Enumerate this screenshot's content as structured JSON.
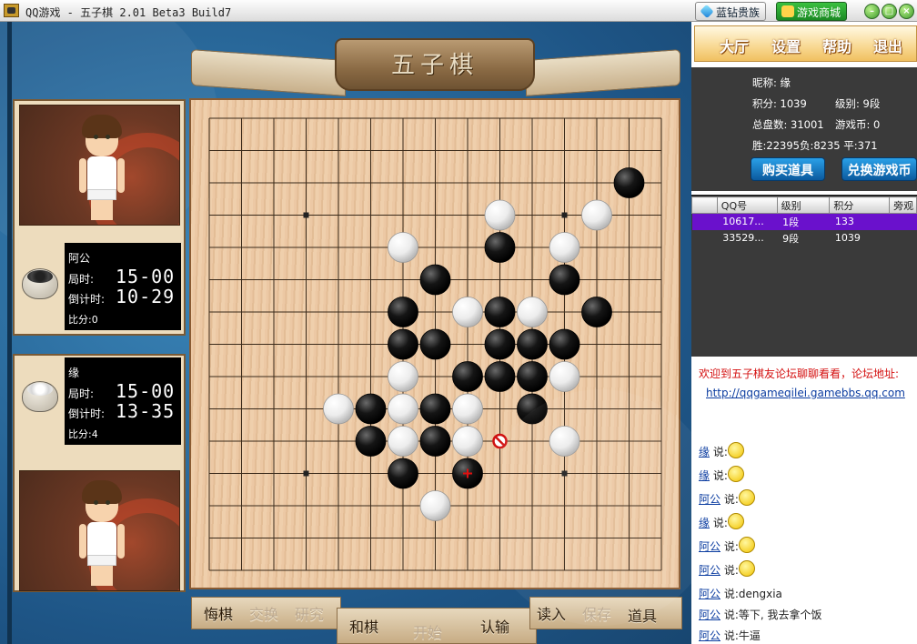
{
  "window": {
    "title": "QQ游戏 - 五子棋   2.01 Beta3 Build7",
    "vip_label": "蓝钻贵族",
    "mall_label": "游戏商城",
    "minimize": "–",
    "restore": "□",
    "close": "×"
  },
  "game": {
    "title": "五子棋"
  },
  "players": [
    {
      "name": "阿公",
      "game_time_label": "局时:",
      "game_time": "15-00",
      "countdown_label": "倒计时:",
      "countdown": "10-29",
      "score": "比分:0",
      "stone": "black"
    },
    {
      "name": "缘",
      "game_time_label": "局时:",
      "game_time": "15-00",
      "countdown_label": "倒计时:",
      "countdown": "13-35",
      "score": "比分:4",
      "stone": "white"
    }
  ],
  "board": {
    "size": 15,
    "stars": [
      [
        3,
        3
      ],
      [
        3,
        11
      ],
      [
        11,
        3
      ],
      [
        11,
        11
      ]
    ],
    "black": [
      [
        13,
        2
      ],
      [
        9,
        4
      ],
      [
        7,
        5
      ],
      [
        11,
        5
      ],
      [
        6,
        6
      ],
      [
        9,
        6
      ],
      [
        12,
        6
      ],
      [
        6,
        7
      ],
      [
        7,
        7
      ],
      [
        9,
        7
      ],
      [
        10,
        7
      ],
      [
        11,
        7
      ],
      [
        8,
        8
      ],
      [
        9,
        8
      ],
      [
        10,
        8
      ],
      [
        5,
        9
      ],
      [
        7,
        9
      ],
      [
        10,
        9
      ],
      [
        5,
        10
      ],
      [
        7,
        10
      ],
      [
        6,
        11
      ],
      [
        8,
        11
      ]
    ],
    "white": [
      [
        9,
        3
      ],
      [
        12,
        3
      ],
      [
        6,
        4
      ],
      [
        11,
        4
      ],
      [
        8,
        6
      ],
      [
        9,
        6.0001
      ],
      [
        10,
        6
      ],
      [
        7,
        7.0001
      ],
      [
        9,
        7.0001
      ],
      [
        6,
        8
      ],
      [
        11,
        8
      ],
      [
        4,
        9
      ],
      [
        6,
        9
      ],
      [
        8,
        9
      ],
      [
        6,
        10
      ],
      [
        8,
        10
      ],
      [
        11,
        10
      ],
      [
        7,
        12
      ]
    ],
    "last_move": [
      8,
      11
    ],
    "forbidden": [
      9,
      10
    ]
  },
  "controls": {
    "undo": "悔棋",
    "swap": "交换",
    "study": "研究",
    "draw": "和棋",
    "start": "开始",
    "resign": "认输",
    "load": "读入",
    "save": "保存",
    "tools": "道具"
  },
  "nav": {
    "lobby": "大厅",
    "settings": "设置",
    "help": "帮助",
    "exit": "退出"
  },
  "user": {
    "nickname": "昵称: 缘",
    "points": "积分: 1039",
    "level": "级别: 9段",
    "total_games": "总盘数:   31001",
    "coins": "游戏币: 0",
    "record": "胜:22395负:8235 平:371"
  },
  "buttons": {
    "buy_items": "购买道具",
    "exchange_coins": "兑换游戏币"
  },
  "table": {
    "headers": [
      "QQ号",
      "级别",
      "积分",
      "旁观"
    ],
    "rows": [
      {
        "qq": "10617...",
        "level": "1段",
        "points": "133",
        "selected": true
      },
      {
        "qq": "33529...",
        "level": "9段",
        "points": "1039",
        "selected": false
      }
    ]
  },
  "chat": {
    "welcome": "欢迎到五子棋友论坛聊聊看看，论坛地址:",
    "url": "http://qqgameqilei.gamebbs.qq.com",
    "said": "说:",
    "messages": [
      {
        "user": "缘",
        "text": "",
        "smiley": true
      },
      {
        "user": "缘",
        "text": "",
        "smiley": true
      },
      {
        "user": "阿公",
        "text": "",
        "smiley": true
      },
      {
        "user": "缘",
        "text": "",
        "smiley": true
      },
      {
        "user": "阿公",
        "text": "",
        "smiley": true
      },
      {
        "user": "阿公",
        "text": "",
        "smiley": true
      },
      {
        "user": "阿公",
        "text": "dengxia",
        "smiley": false
      },
      {
        "user": "阿公",
        "text": "等下, 我去拿个饭",
        "smiley": false
      },
      {
        "user": "阿公",
        "text": "牛逼",
        "smiley": false
      }
    ]
  }
}
